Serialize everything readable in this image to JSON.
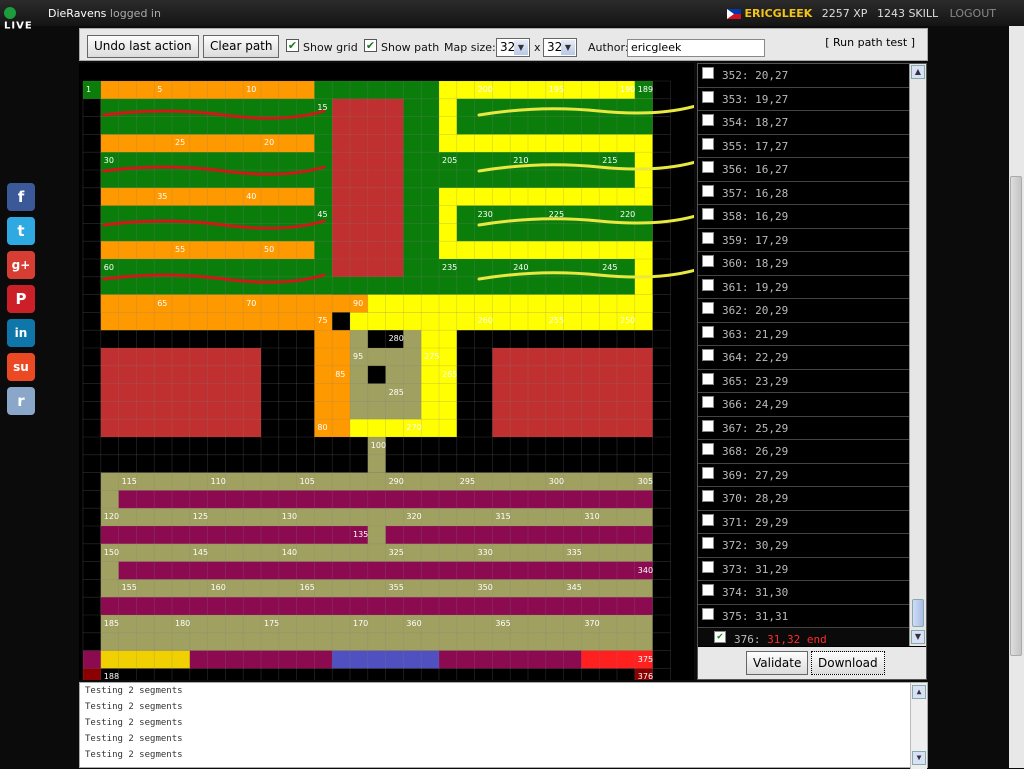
{
  "topbar": {
    "logo_text": "LIVE",
    "username_logged": "DieRavens",
    "logged_in_text": "logged in",
    "user": "ERICGLEEK",
    "xp": "2257 XP",
    "skill": "1243 SKILL",
    "logout": "LOGOUT"
  },
  "toolbar": {
    "undo_label": "Undo last action",
    "clear_label": "Clear path",
    "show_grid_label": "Show grid",
    "show_path_label": "Show path",
    "map_size_label": "Map size:",
    "map_w": "32",
    "map_x": "x",
    "map_h": "32",
    "author_label": "Author:",
    "author_value": "ericgleek",
    "run_test_label": "[ Run path test ]"
  },
  "social": [
    "f",
    "t",
    "g+",
    "P",
    "in",
    "su",
    "r"
  ],
  "map_labels": [
    {
      "t": "1",
      "c": 0,
      "r": 0
    },
    {
      "t": "5",
      "c": 4,
      "r": 0
    },
    {
      "t": "10",
      "c": 9,
      "r": 0
    },
    {
      "t": "15",
      "c": 13,
      "r": 1
    },
    {
      "t": "25",
      "c": 5,
      "r": 3
    },
    {
      "t": "20",
      "c": 10,
      "r": 3
    },
    {
      "t": "30",
      "c": 1,
      "r": 4
    },
    {
      "t": "35",
      "c": 4,
      "r": 6
    },
    {
      "t": "40",
      "c": 9,
      "r": 6
    },
    {
      "t": "45",
      "c": 13,
      "r": 7
    },
    {
      "t": "55",
      "c": 5,
      "r": 9
    },
    {
      "t": "50",
      "c": 10,
      "r": 9
    },
    {
      "t": "60",
      "c": 1,
      "r": 10
    },
    {
      "t": "65",
      "c": 4,
      "r": 12
    },
    {
      "t": "70",
      "c": 9,
      "r": 12
    },
    {
      "t": "75",
      "c": 13,
      "r": 13
    },
    {
      "t": "90",
      "c": 15,
      "r": 12
    },
    {
      "t": "80",
      "c": 13,
      "r": 19
    },
    {
      "t": "85",
      "c": 14,
      "r": 16
    },
    {
      "t": "95",
      "c": 15,
      "r": 15
    },
    {
      "t": "100",
      "c": 16,
      "r": 20
    },
    {
      "t": "200",
      "c": 22,
      "r": 0
    },
    {
      "t": "195",
      "c": 26,
      "r": 0
    },
    {
      "t": "190",
      "c": 30,
      "r": 0
    },
    {
      "t": "189",
      "c": 31,
      "r": 0
    },
    {
      "t": "205",
      "c": 20,
      "r": 4
    },
    {
      "t": "210",
      "c": 24,
      "r": 4
    },
    {
      "t": "215",
      "c": 29,
      "r": 4
    },
    {
      "t": "230",
      "c": 22,
      "r": 7
    },
    {
      "t": "225",
      "c": 26,
      "r": 7
    },
    {
      "t": "220",
      "c": 30,
      "r": 7
    },
    {
      "t": "235",
      "c": 20,
      "r": 10
    },
    {
      "t": "240",
      "c": 24,
      "r": 10
    },
    {
      "t": "245",
      "c": 29,
      "r": 10
    },
    {
      "t": "260",
      "c": 22,
      "r": 13
    },
    {
      "t": "255",
      "c": 26,
      "r": 13
    },
    {
      "t": "250",
      "c": 30,
      "r": 13
    },
    {
      "t": "280",
      "c": 17,
      "r": 14
    },
    {
      "t": "275",
      "c": 19,
      "r": 15
    },
    {
      "t": "265",
      "c": 20,
      "r": 16
    },
    {
      "t": "285",
      "c": 17,
      "r": 17
    },
    {
      "t": "270",
      "c": 18,
      "r": 19
    },
    {
      "t": "115",
      "c": 2,
      "r": 22
    },
    {
      "t": "110",
      "c": 7,
      "r": 22
    },
    {
      "t": "105",
      "c": 12,
      "r": 22
    },
    {
      "t": "290",
      "c": 17,
      "r": 22
    },
    {
      "t": "295",
      "c": 21,
      "r": 22
    },
    {
      "t": "300",
      "c": 26,
      "r": 22
    },
    {
      "t": "305",
      "c": 31,
      "r": 22
    },
    {
      "t": "120",
      "c": 1,
      "r": 24
    },
    {
      "t": "125",
      "c": 6,
      "r": 24
    },
    {
      "t": "130",
      "c": 11,
      "r": 24
    },
    {
      "t": "320",
      "c": 18,
      "r": 24
    },
    {
      "t": "315",
      "c": 23,
      "r": 24
    },
    {
      "t": "310",
      "c": 28,
      "r": 24
    },
    {
      "t": "135",
      "c": 15,
      "r": 25
    },
    {
      "t": "150",
      "c": 1,
      "r": 26
    },
    {
      "t": "145",
      "c": 6,
      "r": 26
    },
    {
      "t": "140",
      "c": 11,
      "r": 26
    },
    {
      "t": "325",
      "c": 17,
      "r": 26
    },
    {
      "t": "330",
      "c": 22,
      "r": 26
    },
    {
      "t": "335",
      "c": 27,
      "r": 26
    },
    {
      "t": "340",
      "c": 31,
      "r": 27
    },
    {
      "t": "155",
      "c": 2,
      "r": 28
    },
    {
      "t": "160",
      "c": 7,
      "r": 28
    },
    {
      "t": "165",
      "c": 12,
      "r": 28
    },
    {
      "t": "355",
      "c": 17,
      "r": 28
    },
    {
      "t": "350",
      "c": 22,
      "r": 28
    },
    {
      "t": "345",
      "c": 27,
      "r": 28
    },
    {
      "t": "185",
      "c": 1,
      "r": 30
    },
    {
      "t": "180",
      "c": 5,
      "r": 30
    },
    {
      "t": "175",
      "c": 10,
      "r": 30
    },
    {
      "t": "170",
      "c": 15,
      "r": 30
    },
    {
      "t": "360",
      "c": 18,
      "r": 30
    },
    {
      "t": "365",
      "c": 23,
      "r": 30
    },
    {
      "t": "370",
      "c": 28,
      "r": 30
    },
    {
      "t": "375",
      "c": 31,
      "r": 32
    },
    {
      "t": "188",
      "c": 1,
      "r": 33
    },
    {
      "t": "376",
      "c": 31,
      "r": 33
    }
  ],
  "path_list": [
    {
      "n": "352:",
      "xy": "20,27"
    },
    {
      "n": "353:",
      "xy": "19,27"
    },
    {
      "n": "354:",
      "xy": "18,27"
    },
    {
      "n": "355:",
      "xy": "17,27"
    },
    {
      "n": "356:",
      "xy": "16,27"
    },
    {
      "n": "357:",
      "xy": "16,28"
    },
    {
      "n": "358:",
      "xy": "16,29"
    },
    {
      "n": "359:",
      "xy": "17,29"
    },
    {
      "n": "360:",
      "xy": "18,29"
    },
    {
      "n": "361:",
      "xy": "19,29"
    },
    {
      "n": "362:",
      "xy": "20,29"
    },
    {
      "n": "363:",
      "xy": "21,29"
    },
    {
      "n": "364:",
      "xy": "22,29"
    },
    {
      "n": "365:",
      "xy": "23,29"
    },
    {
      "n": "366:",
      "xy": "24,29"
    },
    {
      "n": "367:",
      "xy": "25,29"
    },
    {
      "n": "368:",
      "xy": "26,29"
    },
    {
      "n": "369:",
      "xy": "27,29"
    },
    {
      "n": "370:",
      "xy": "28,29"
    },
    {
      "n": "371:",
      "xy": "29,29"
    },
    {
      "n": "372:",
      "xy": "30,29"
    },
    {
      "n": "373:",
      "xy": "31,29"
    },
    {
      "n": "374:",
      "xy": "31,30"
    },
    {
      "n": "375:",
      "xy": "31,31"
    }
  ],
  "path_last": {
    "n": "376:",
    "xy": "31,32 end"
  },
  "side_buttons": {
    "validate": "Validate",
    "download": "Download"
  },
  "log_lines": [
    "Testing 2 segments",
    "Testing 2 segments",
    "Testing 2 segments",
    "Testing 2 segments",
    "Testing 2 segments"
  ],
  "colors": {
    "orange": "#ff9900",
    "green": "#0b7d0b",
    "yellow": "#ffff00",
    "olive": "#a0a060",
    "maroon": "#8b0a50",
    "black": "#000000"
  }
}
